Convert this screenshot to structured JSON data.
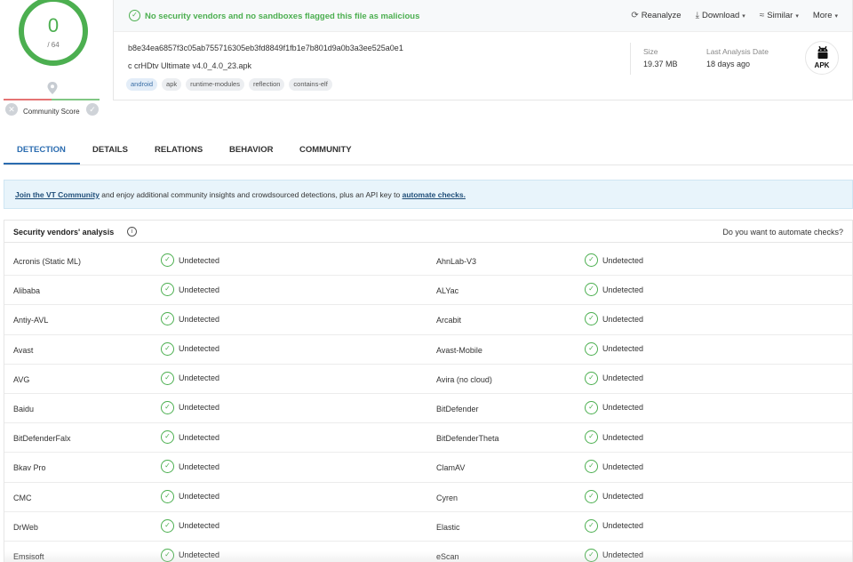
{
  "score": {
    "value": "0",
    "total": "/ 64",
    "community_label": "Community Score"
  },
  "status": {
    "text": "No security vendors and no sandboxes flagged this file as malicious"
  },
  "actions": {
    "reanalyze": "Reanalyze",
    "download": "Download",
    "similar": "Similar",
    "more": "More"
  },
  "file": {
    "hash": "b8e34ea6857f3c05ab755716305eb3fd8849f1fb1e7b801d9a0b3a3ee525a0e1",
    "name": "c crHDtv Ultimate v4.0_4.0_23.apk",
    "tags": [
      "android",
      "apk",
      "runtime-modules",
      "reflection",
      "contains-elf"
    ],
    "size_label": "Size",
    "size_value": "19.37 MB",
    "date_label": "Last Analysis Date",
    "date_value": "18 days ago",
    "type_badge": "APK"
  },
  "tabs": [
    "DETECTION",
    "DETAILS",
    "RELATIONS",
    "BEHAVIOR",
    "COMMUNITY"
  ],
  "banner": {
    "link1": "Join the VT Community",
    "middle": " and enjoy additional community insights and crowdsourced detections, plus an API key to ",
    "link2": "automate checks."
  },
  "vendors": {
    "title": "Security vendors' analysis",
    "automate": "Do you want to automate checks?",
    "rows": [
      [
        {
          "name": "Acronis (Static ML)",
          "result": "Undetected"
        },
        {
          "name": "AhnLab-V3",
          "result": "Undetected"
        }
      ],
      [
        {
          "name": "Alibaba",
          "result": "Undetected"
        },
        {
          "name": "ALYac",
          "result": "Undetected"
        }
      ],
      [
        {
          "name": "Antiy-AVL",
          "result": "Undetected"
        },
        {
          "name": "Arcabit",
          "result": "Undetected"
        }
      ],
      [
        {
          "name": "Avast",
          "result": "Undetected"
        },
        {
          "name": "Avast-Mobile",
          "result": "Undetected"
        }
      ],
      [
        {
          "name": "AVG",
          "result": "Undetected"
        },
        {
          "name": "Avira (no cloud)",
          "result": "Undetected"
        }
      ],
      [
        {
          "name": "Baidu",
          "result": "Undetected"
        },
        {
          "name": "BitDefender",
          "result": "Undetected"
        }
      ],
      [
        {
          "name": "BitDefenderFalx",
          "result": "Undetected"
        },
        {
          "name": "BitDefenderTheta",
          "result": "Undetected"
        }
      ],
      [
        {
          "name": "Bkav Pro",
          "result": "Undetected"
        },
        {
          "name": "ClamAV",
          "result": "Undetected"
        }
      ],
      [
        {
          "name": "CMC",
          "result": "Undetected"
        },
        {
          "name": "Cyren",
          "result": "Undetected"
        }
      ],
      [
        {
          "name": "DrWeb",
          "result": "Undetected"
        },
        {
          "name": "Elastic",
          "result": "Undetected"
        }
      ],
      [
        {
          "name": "Emsisoft",
          "result": "Undetected"
        },
        {
          "name": "eScan",
          "result": "Undetected"
        }
      ]
    ]
  },
  "colors": {
    "clean": "#4caf50",
    "accent": "#2b6cb0",
    "banner_bg": "#e8f4fb"
  },
  "icons": {
    "status": "check-circle-icon",
    "reanalyze": "refresh-icon",
    "download": "download-icon",
    "similar": "similar-icon",
    "badge": "android-icon"
  }
}
